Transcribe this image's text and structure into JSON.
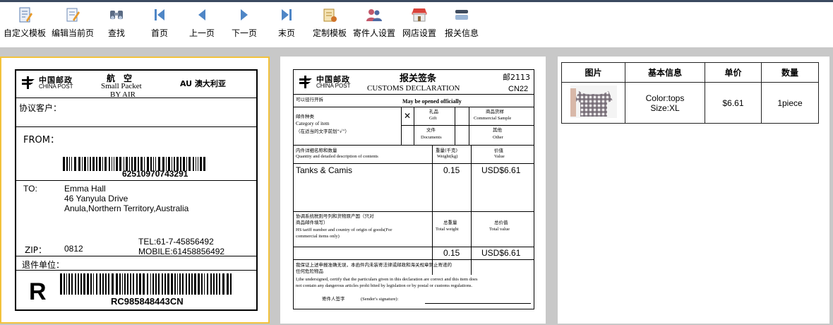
{
  "toolbar": {
    "items": [
      {
        "label": "自定义模板",
        "icon": "custom-template-icon"
      },
      {
        "label": "编辑当前页",
        "icon": "edit-page-icon"
      },
      {
        "label": "查找",
        "icon": "find-icon"
      },
      {
        "label": "首页",
        "icon": "first-page-icon"
      },
      {
        "label": "上一页",
        "icon": "previous-page-icon"
      },
      {
        "label": "下一页",
        "icon": "next-page-icon"
      },
      {
        "label": "末页",
        "icon": "last-page-icon"
      },
      {
        "label": "定制模板",
        "icon": "template-config-icon"
      },
      {
        "label": "寄件人设置",
        "icon": "sender-settings-icon"
      },
      {
        "label": "网店设置",
        "icon": "store-settings-icon"
      },
      {
        "label": "报关信息",
        "icon": "customs-info-icon"
      }
    ]
  },
  "label": {
    "logo_cn": "中国邮政",
    "logo_en": "CHINA POST",
    "airmail_cn": "航　空",
    "small_packet": "Small Packet",
    "by_air": "BY AIR",
    "country": "AU  澳大利亚",
    "agreement_client": "协议客户：",
    "from": "FROM：",
    "barcode_number": "62510970743291",
    "to_label": "TO:",
    "to_name": "Emma Hall",
    "to_line1": "46 Yanyula Drive",
    "to_line2": "Anula,Northern Territory,Australia",
    "tel": "TEL:61-7-45856492",
    "mobile": "MOBILE:61458856492",
    "zip_label": "ZIP：",
    "zip": "0812",
    "return_unit": "退件单位：",
    "registered_mark": "R",
    "tracking": "RC985848443CN"
  },
  "customs": {
    "logo_cn": "中国邮政",
    "logo_en": "CHINA POST",
    "title_cn": "报关签条",
    "title_en": "CUSTOMS DECLARATION",
    "post_code": "邮2113",
    "cn_code": "CN22",
    "may_open_cn": "可以径行开拆",
    "may_open_en": "May be opened officially",
    "category_cn": "邮件种类",
    "category_en": "Category of item",
    "category_hint": "（在适当的文字前划“√”）",
    "check_mark": "✕",
    "gift_cn": "礼品",
    "gift_en": "Gift",
    "sample_cn": "商品货样",
    "sample_en": "Commercial Sample",
    "docs_cn": "文件",
    "docs_en": "Documents",
    "other_cn": "其他",
    "other_en": "Other",
    "contents_cn": "内件详细名称和数量",
    "contents_en": "Quantity and detailed description of contents",
    "weight_cn": "重量(千克)",
    "weight_en": "Weight(kg)",
    "value_cn": "价值",
    "value_en": "Value",
    "item_desc": "Tanks & Camis",
    "item_weight": "0.15",
    "item_value": "USD$6.61",
    "hs_cn1": "协调系统税则号列和货物原产国（只对",
    "hs_cn2": "商品邮件填写）",
    "hs_en1": "HS tariff number and country of origin of goods(For",
    "hs_en2": "commercial items only)",
    "total_weight_cn": "总重量",
    "total_weight_en": "Total weight",
    "total_value_cn": "总价值",
    "total_value_en": "Total value",
    "total_weight": "0.15",
    "total_value": "USD$6.61",
    "declare_cn1": "我保证上述申报准确无误，本函件内未装寄法律或邮政和海关规章禁止寄递的",
    "declare_cn2": "任何危险物品",
    "declare_en1": "I,the undersigned, certify that the particulars given in this declaration are correct and this item does",
    "declare_en2": "not contain any dangerous articles prohi bited by legislation or by postal or customs regulations.",
    "signature_cn": "寄件人签字",
    "signature_en": "(Sender's signature):"
  },
  "order": {
    "headers": [
      "图片",
      "基本信息",
      "单价",
      "数量"
    ],
    "row": {
      "info_line1": "Color:tops",
      "info_line2": "Size:XL",
      "price": "$6.61",
      "qty": "1piece"
    }
  }
}
